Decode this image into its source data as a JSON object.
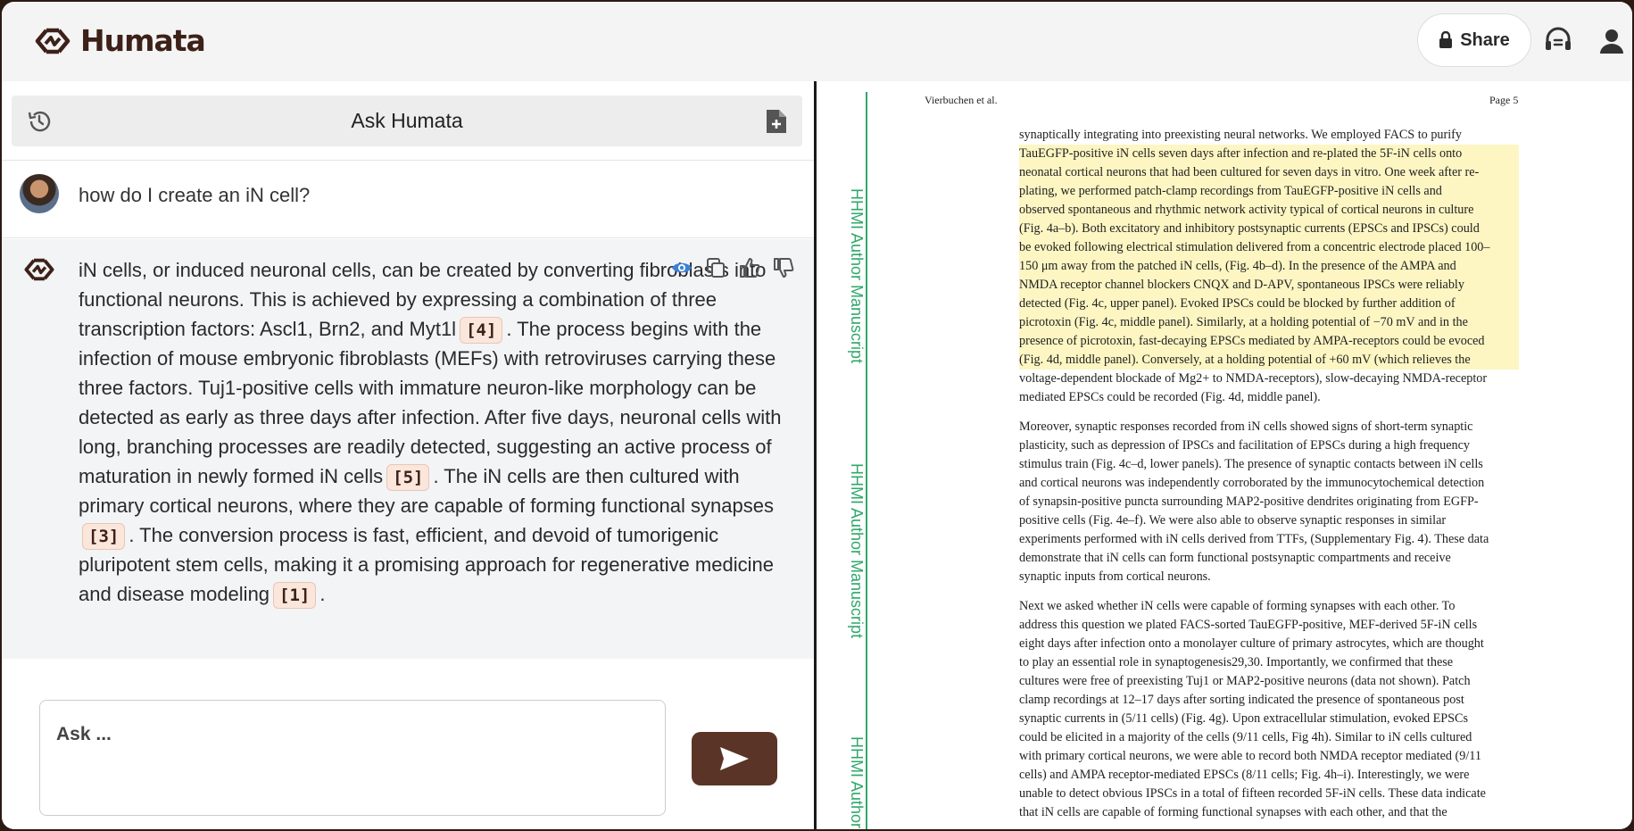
{
  "app": {
    "name": "Humata",
    "share_label": "Share"
  },
  "colors": {
    "brand": "#3d2118",
    "send_button": "#5a3426",
    "highlight": "#fdf6c3",
    "watermark": "#2fa86a",
    "citation_bg": "#fbe6dc"
  },
  "icons": {
    "logo": "humata-logo-icon",
    "share": "lock-icon",
    "support": "headset-icon",
    "account": "user-icon",
    "history": "history-icon",
    "new_doc": "new-document-icon",
    "view": "eye-icon",
    "copy": "copy-icon",
    "thumbs_up": "thumbs-up-icon",
    "thumbs_down": "thumbs-down-icon",
    "send": "send-icon"
  },
  "chat": {
    "title": "Ask Humata",
    "question": "how do I create an iN cell?",
    "answer": {
      "seg1": "iN cells, or induced neuronal cells, can be created by converting fibroblasts into functional neurons. This is achieved by expressing a combination of three transcription factors: Ascl1, Brn2, and Myt1l",
      "cite1": "[4]",
      "seg2": ". The process begins with the infection of mouse embryonic fibroblasts (MEFs) with retroviruses carrying these three factors. Tuj1-positive cells with immature neuron-like morphology can be detected as early as three days after infection. After five days, neuronal cells with long, branching processes are readily detected, suggesting an active process of maturation in newly formed iN cells",
      "cite2": "[5]",
      "seg3": ". The iN cells are then cultured with primary cortical neurons, where they are capable of forming functional synapses",
      "cite3": "[3]",
      "seg4": ". The conversion process is fast, efficient, and devoid of tumorigenic pluripotent stem cells, making it a promising approach for regenerative medicine and disease modeling",
      "cite4": "[1]",
      "seg5": "."
    },
    "input_placeholder": "Ask ..."
  },
  "document": {
    "header_left": "Vierbuchen et al.",
    "header_right": "Page 5",
    "side_labels": [
      "HHMI Author Manuscript",
      "HHMI Author Manuscript",
      "HHMI Author"
    ],
    "p1": [
      "synaptically integrating into preexisting neural networks. We employed FACS to purify",
      "TauEGFP-positive iN cells seven days after infection and re-plated the 5F-iN cells onto",
      "neonatal cortical neurons that had been cultured for seven days in vitro. One week after re-",
      "plating, we performed patch-clamp recordings from TauEGFP-positive iN cells and",
      "observed spontaneous and rhythmic network activity typical of cortical neurons in culture",
      "(Fig. 4a–b). Both excitatory and inhibitory postsynaptic currents (EPSCs and IPSCs) could",
      "be evoked following electrical stimulation delivered from a concentric electrode placed 100–",
      "150 μm away from the patched iN cells, (Fig. 4b–d). In the presence of the AMPA and",
      "NMDA receptor channel blockers CNQX and D-APV, spontaneous IPSCs were reliably",
      "detected (Fig. 4c, upper panel). Evoked IPSCs could be blocked by further addition of",
      "picrotoxin (Fig. 4c, middle panel). Similarly, at a holding potential of −70 mV and in the",
      "presence of picrotoxin, fast-decaying EPSCs mediated by AMPA-receptors could be evoced",
      "(Fig. 4d, middle panel). Conversely, at a holding potential of +60 mV (which relieves the",
      "voltage-dependent blockade of Mg2+ to NMDA-receptors), slow-decaying NMDA-receptor",
      "mediated EPSCs could be recorded (Fig. 4d, middle panel)."
    ],
    "p2": [
      "Moreover, synaptic responses recorded from iN cells showed signs of short-term synaptic",
      "plasticity, such as depression of IPSCs and facilitation of EPSCs during a high frequency",
      "stimulus train (Fig. 4c–d, lower panels). The presence of synaptic contacts between iN cells",
      "and cortical neurons was independently corroborated by the immunocytochemical detection",
      "of synapsin-positive puncta surrounding MAP2-positive dendrites originating from EGFP-",
      "positive cells (Fig. 4e–f). We were also able to observe synaptic responses in similar",
      "experiments performed with iN cells derived from TTFs, (Supplementary Fig. 4). These data",
      "demonstrate that iN cells can form functional postsynaptic compartments and receive",
      "synaptic inputs from cortical neurons."
    ],
    "p3": [
      "Next we asked whether iN cells were capable of forming synapses with each other. To",
      "address this question we plated FACS-sorted TauEGFP-positive, MEF-derived 5F-iN cells",
      "eight days after infection onto a monolayer culture of primary astrocytes, which are thought",
      "to play an essential role in synaptogenesis29,30. Importantly, we confirmed that these",
      "cultures were free of preexisting Tuj1 or MAP2-positive neurons (data not shown). Patch",
      "clamp recordings at 12–17 days after sorting indicated the presence of spontaneous post",
      "synaptic currents in (5/11 cells) (Fig. 4g). Upon extracellular stimulation, evoked EPSCs",
      "could be elicited in a majority of the cells (9/11 cells, Fig 4h). Similar to iN cells cultured",
      "with primary cortical neurons, we were able to record both NMDA receptor mediated (9/11",
      "cells) and AMPA receptor-mediated EPSCs (8/11 cells; Fig. 4h–i). Interestingly, we were",
      "unable to detect obvious IPSCs in a total of fifteen recorded 5F-iN cells. These data indicate",
      "that iN cells are capable of forming functional synapses with each other, and that the"
    ]
  }
}
